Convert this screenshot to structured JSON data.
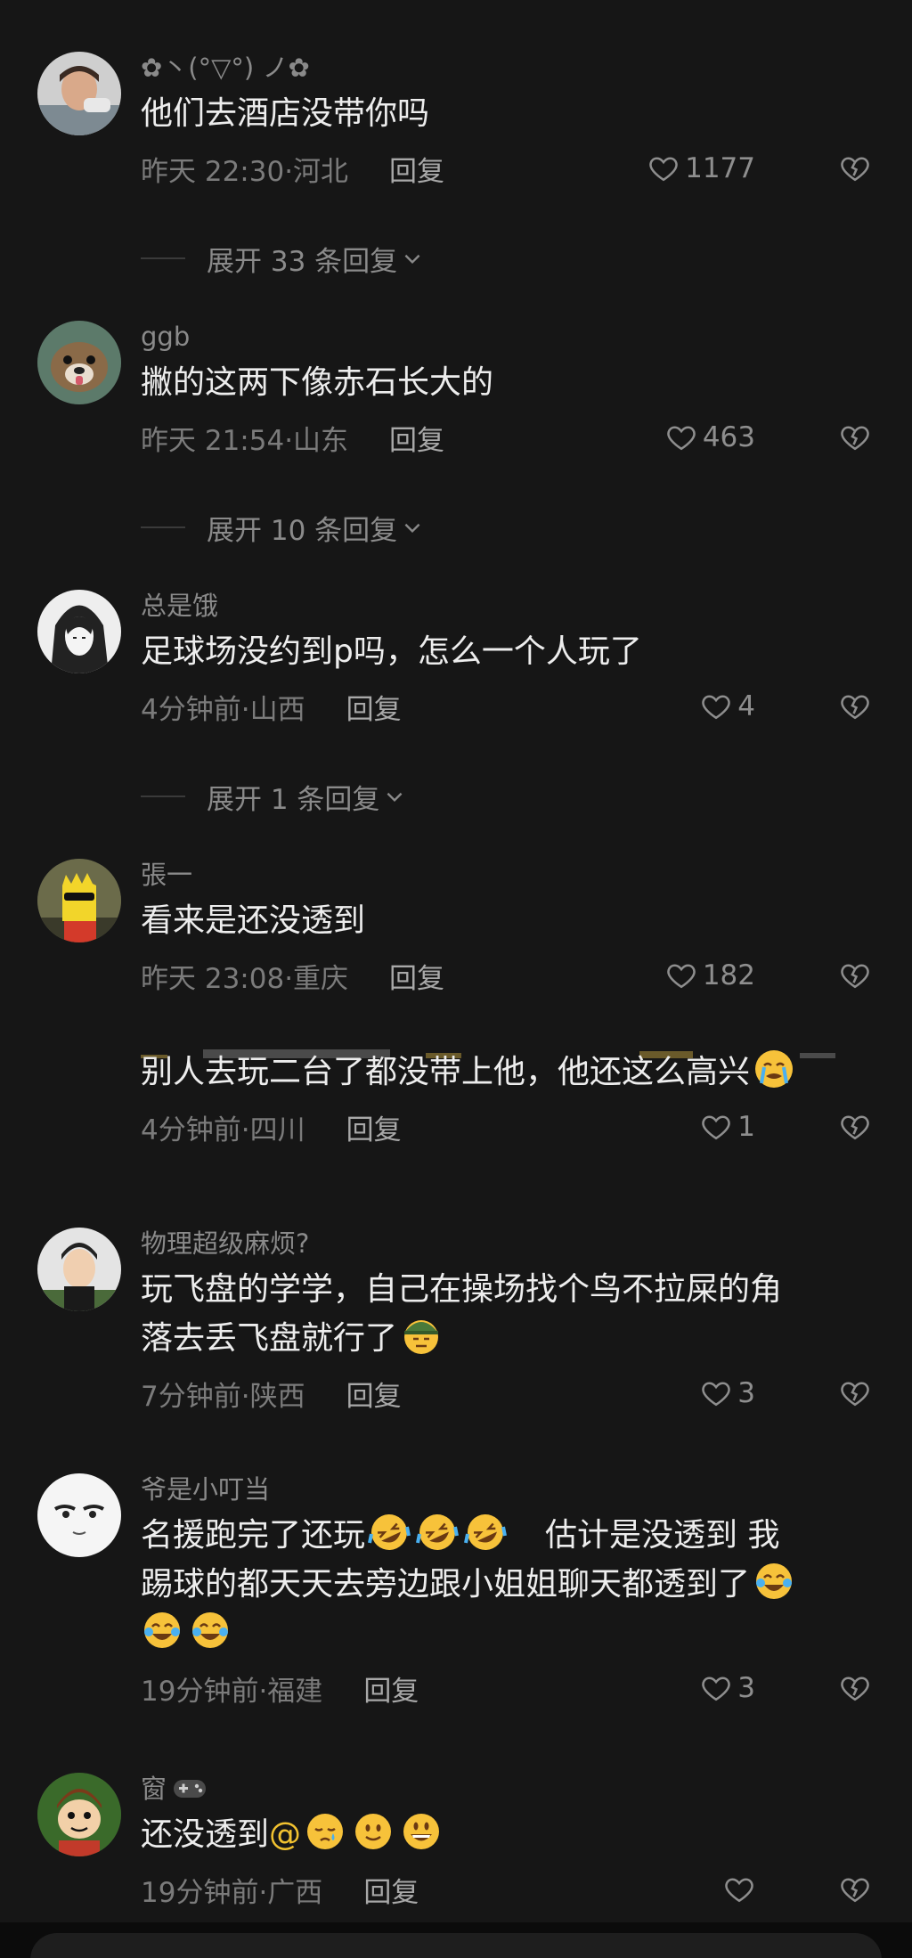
{
  "comments": [
    {
      "username": "✿丶(°▽°) ノ✿",
      "text": "他们去酒店没带你吗",
      "time": "昨天 22:30·河北",
      "reply_label": "回复",
      "likes": "1177",
      "expand_label": "展开 33 条回复"
    },
    {
      "username": "ggb",
      "text": "撇的这两下像赤石长大的",
      "time": "昨天 21:54·山东",
      "reply_label": "回复",
      "likes": "463",
      "expand_label": "展开 10 条回复"
    },
    {
      "username": "总是饿",
      "text": "足球场没约到p吗，怎么一个人玩了",
      "time": "4分钟前·山西",
      "reply_label": "回复",
      "likes": "4",
      "expand_label": "展开 1 条回复"
    },
    {
      "username": "張一",
      "text": "看来是还没透到",
      "time": "昨天 23:08·重庆",
      "reply_label": "回复",
      "likes": "182"
    },
    {
      "text": "别人去玩二台了都没带上他，他还这么高兴",
      "time": "4分钟前·四川",
      "reply_label": "回复",
      "likes": "1"
    },
    {
      "username": "物理超级麻烦?",
      "text_line1": "玩飞盘的学学，自己在操场找个鸟不拉屎的角",
      "text_line2": "落去丢飞盘就行了",
      "time": "7分钟前·陕西",
      "reply_label": "回复",
      "likes": "3"
    },
    {
      "username": "爷是小叮当",
      "text_part1": "名援跑完了还玩",
      "text_part2": "估计是没透到 我",
      "text_line2": "踢球的都天天去旁边跟小姐姐聊天都透到了",
      "time": "19分钟前·福建",
      "reply_label": "回复",
      "likes": "3"
    },
    {
      "username": "窗",
      "text": "还没透到",
      "at_symbol": "@",
      "time": "19分钟前·广西",
      "reply_label": "回复"
    }
  ],
  "colors": {
    "background": "#161616",
    "text_primary": "#ededed",
    "text_secondary": "#8a8a8a",
    "at_color": "#f2c230"
  },
  "icons": {
    "like": "heart-outline-icon",
    "dislike": "broken-heart-icon",
    "expand": "chevron-down-icon"
  }
}
